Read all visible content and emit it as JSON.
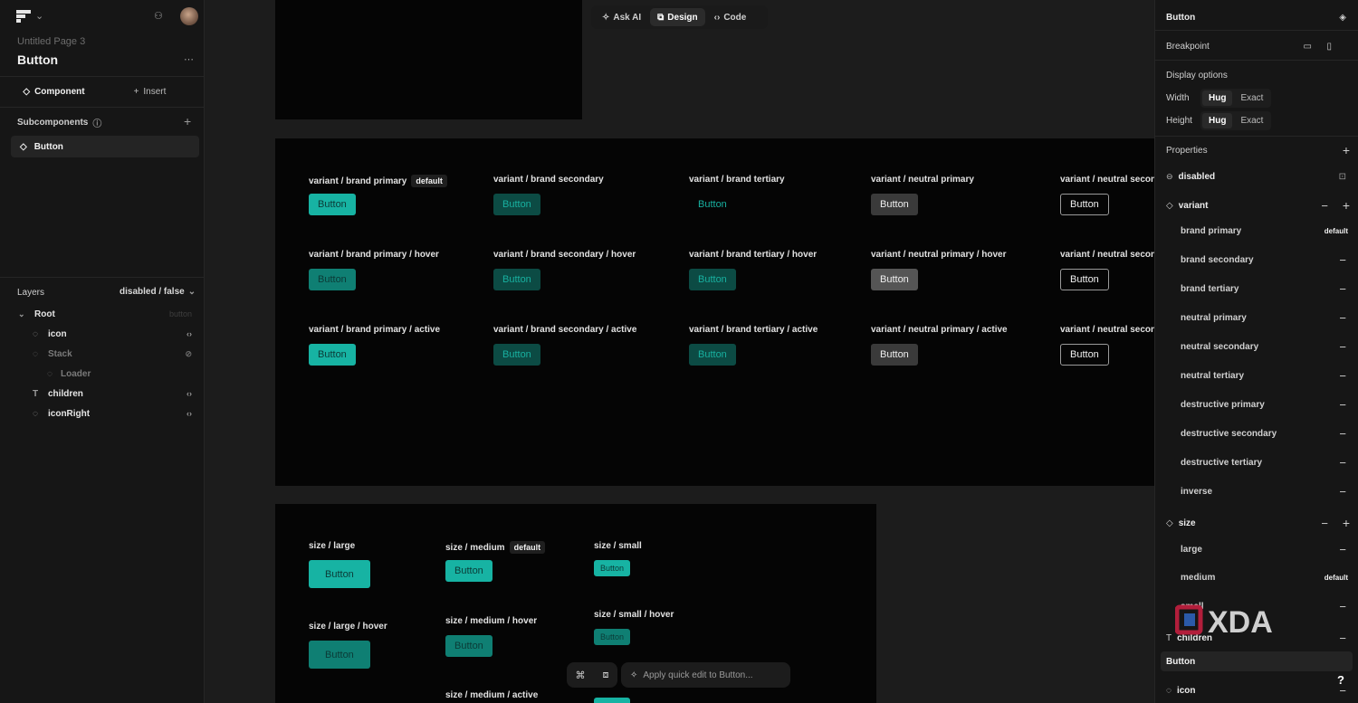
{
  "left_panel": {
    "page_title": "Untitled Page 3",
    "component_name": "Button",
    "tabs": [
      {
        "label": "Component"
      },
      {
        "label": "Insert"
      }
    ],
    "subcomponents_label": "Subcomponents",
    "subcomponent_item": "Button",
    "layers_label": "Layers",
    "layers_filter": "disabled / false",
    "layers": [
      {
        "label": "Root",
        "tag": "button"
      },
      {
        "label": "icon"
      },
      {
        "label": "Stack"
      },
      {
        "label": "Loader"
      },
      {
        "label": "children"
      },
      {
        "label": "iconRight"
      }
    ]
  },
  "toolbar": {
    "items": [
      {
        "label": "Ask AI"
      },
      {
        "label": "Design"
      },
      {
        "label": "Code"
      }
    ]
  },
  "canvas": {
    "variants": [
      {
        "label": "variant  / brand primary",
        "badge": "default",
        "button": "Button"
      },
      {
        "label": "variant  / brand secondary",
        "button": "Button"
      },
      {
        "label": "variant  / brand tertiary",
        "button": "Button"
      },
      {
        "label": "variant  / neutral primary",
        "button": "Button"
      },
      {
        "label": "variant  / neutral secon",
        "button": "Button"
      },
      {
        "label": "variant  / brand primary  / hover",
        "button": "Button"
      },
      {
        "label": "variant  / brand secondary  / hover",
        "button": "Button"
      },
      {
        "label": "variant  / brand tertiary  / hover",
        "button": "Button"
      },
      {
        "label": "variant  / neutral primary  / hover",
        "button": "Button"
      },
      {
        "label": "variant  / neutral secon",
        "button": "Button"
      },
      {
        "label": "variant  / brand primary  / active",
        "button": "Button"
      },
      {
        "label": "variant  / brand secondary  / active",
        "button": "Button"
      },
      {
        "label": "variant  / brand tertiary  / active",
        "button": "Button"
      },
      {
        "label": "variant  / neutral primary  / active",
        "button": "Button"
      },
      {
        "label": "variant  / neutral secon",
        "button": "Button"
      }
    ],
    "sizes": [
      {
        "label": "size  / large",
        "button": "Button"
      },
      {
        "label": "size  / medium",
        "badge": "default",
        "button": "Button"
      },
      {
        "label": "size  / small",
        "button": "Button"
      },
      {
        "label": "size  / large  / hover",
        "button": "Button"
      },
      {
        "label": "size  / medium  / hover",
        "button": "Button"
      },
      {
        "label": "size  / small  / hover",
        "button": "Button"
      },
      {
        "label": "size  / medium  / active"
      }
    ]
  },
  "quick_edit": {
    "placeholder": "Apply quick edit to Button..."
  },
  "right_panel": {
    "title": "Button",
    "breakpoint_label": "Breakpoint",
    "display_options_label": "Display options",
    "width_label": "Width",
    "height_label": "Height",
    "segment_options": [
      "Hug",
      "Exact"
    ],
    "properties_label": "Properties",
    "prop_disabled": "disabled",
    "prop_variant": "variant",
    "variant_options": [
      {
        "label": "brand primary",
        "badge": "default"
      },
      {
        "label": "brand secondary"
      },
      {
        "label": "brand tertiary"
      },
      {
        "label": "neutral primary"
      },
      {
        "label": "neutral secondary"
      },
      {
        "label": "neutral tertiary"
      },
      {
        "label": "destructive primary"
      },
      {
        "label": "destructive secondary"
      },
      {
        "label": "destructive tertiary"
      },
      {
        "label": "inverse"
      }
    ],
    "prop_size": "size",
    "size_options": [
      {
        "label": "large"
      },
      {
        "label": "medium",
        "badge": "default"
      },
      {
        "label": "small"
      }
    ],
    "prop_children": "children",
    "children_value": "Button",
    "prop_icon": "icon"
  },
  "watermark": {
    "text": "XDA"
  },
  "help_label": "?",
  "colors": {
    "brand": "#17b3a3",
    "canvas_bg": "#1c1c1c",
    "frame_bg": "#050505",
    "panel_bg": "#161616"
  }
}
